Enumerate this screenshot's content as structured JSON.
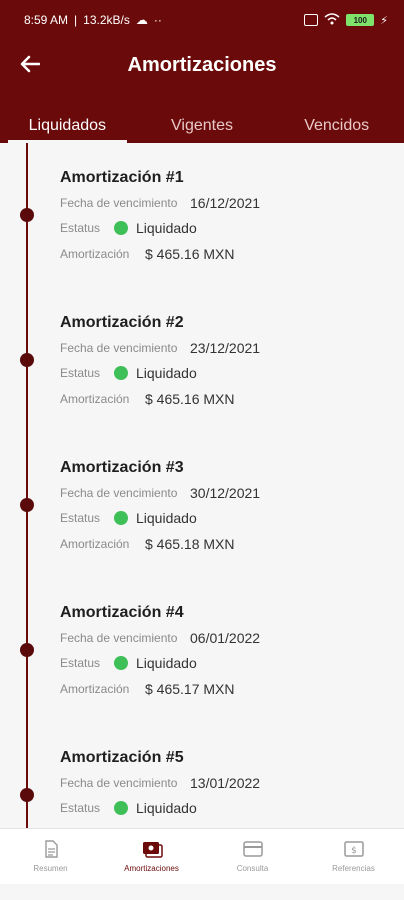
{
  "status": {
    "time": "8:59 AM",
    "speed": "13.2kB/s",
    "battery": "100"
  },
  "header": {
    "title": "Amortizaciones"
  },
  "tabs": [
    {
      "label": "Liquidados"
    },
    {
      "label": "Vigentes"
    },
    {
      "label": "Vencidos"
    }
  ],
  "labels": {
    "due_date": "Fecha de vencimiento",
    "status": "Estatus",
    "amount": "Amortización"
  },
  "items": [
    {
      "title": "Amortización #1",
      "due_date": "16/12/2021",
      "status": "Liquidado",
      "amount": "$ 465.16 MXN"
    },
    {
      "title": "Amortización #2",
      "due_date": "23/12/2021",
      "status": "Liquidado",
      "amount": "$ 465.16 MXN"
    },
    {
      "title": "Amortización #3",
      "due_date": "30/12/2021",
      "status": "Liquidado",
      "amount": "$ 465.18 MXN"
    },
    {
      "title": "Amortización #4",
      "due_date": "06/01/2022",
      "status": "Liquidado",
      "amount": "$ 465.17 MXN"
    },
    {
      "title": "Amortización #5",
      "due_date": "13/01/2022",
      "status": "Liquidado",
      "amount": ""
    }
  ],
  "nav": [
    {
      "label": "Resumen",
      "icon": "document-icon"
    },
    {
      "label": "Amortizaciones",
      "icon": "cash-icon"
    },
    {
      "label": "Consulta",
      "icon": "card-icon"
    },
    {
      "label": "Referencias",
      "icon": "reference-icon"
    }
  ],
  "colors": {
    "primary": "#6b0a0a",
    "status_ok": "#3fbf57"
  }
}
